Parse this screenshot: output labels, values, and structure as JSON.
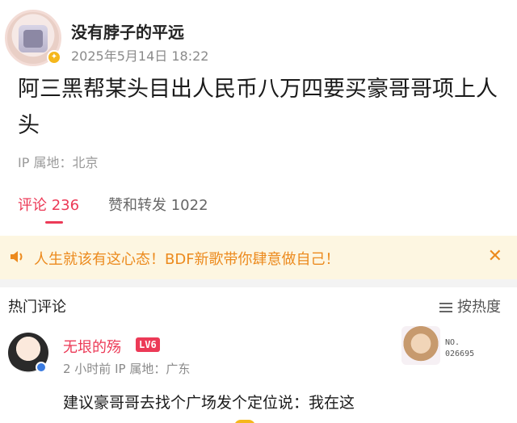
{
  "post": {
    "username": "没有脖子的平远",
    "time": "2025年5月14日 18:22",
    "body": "阿三黑帮某头目出人民币八万四要买豪哥哥项上人头",
    "ip_location": "IP 属地：北京"
  },
  "tabs": [
    {
      "label": "评论 236",
      "active": true
    },
    {
      "label": "赞和转发 1022",
      "active": false
    }
  ],
  "promo": {
    "text": "人生就该有这心态！BDF新歌带你肆意做自己！",
    "close_glyph": "✕",
    "accent": "#ec8a1d"
  },
  "comments_section": {
    "title": "热门评论",
    "sort_label": "按热度"
  },
  "comments": [
    {
      "name": "无垠的殇",
      "level": "LV6",
      "meta": "2 小时前  IP 属地：广东",
      "text": "建议豪哥哥去找个广场发个定位说：我在这",
      "card_no_label": "NO.",
      "card_no": "026695"
    }
  ],
  "colors": {
    "brand": "#ec3a57",
    "promo_bg": "#fdf6e1"
  },
  "icons": {
    "promo": "speaker-icon",
    "sort": "sort-lines-icon",
    "close": "close-icon"
  }
}
